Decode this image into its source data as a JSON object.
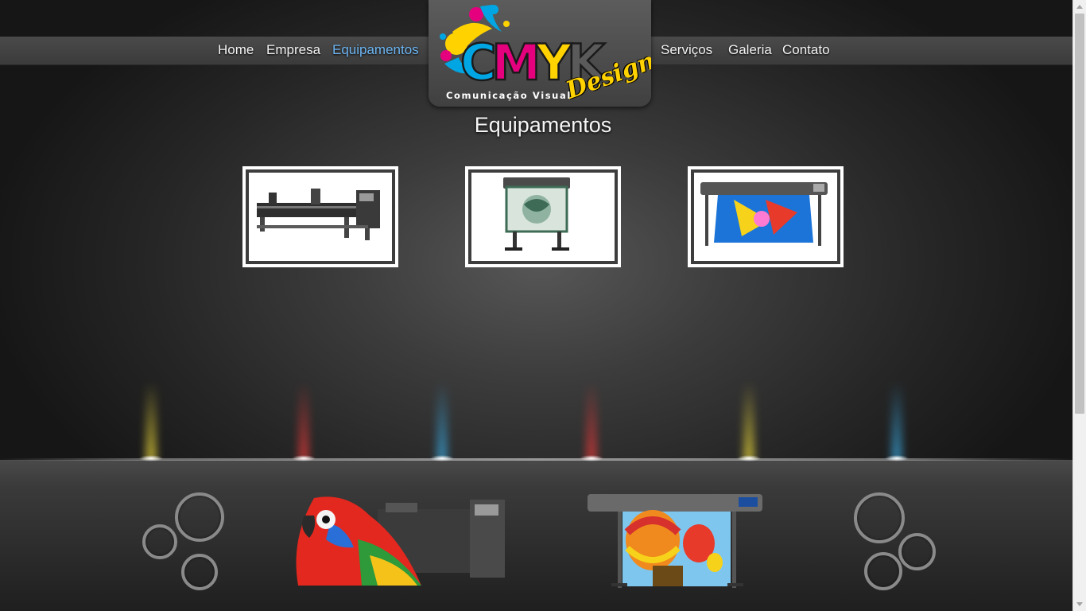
{
  "nav": {
    "items": [
      {
        "label": "Home",
        "active": false
      },
      {
        "label": "Empresa",
        "active": false
      },
      {
        "label": "Equipamentos",
        "active": true
      },
      {
        "label": "Serviços",
        "active": false
      },
      {
        "label": "Galeria",
        "active": false
      },
      {
        "label": "Contato",
        "active": false
      }
    ]
  },
  "logo": {
    "letters": "CMYK",
    "script": "Design",
    "tagline": "Comunicação Visual"
  },
  "page": {
    "title": "Equipamentos"
  },
  "equipment": [
    {
      "icon": "wide-format-printer-icon"
    },
    {
      "icon": "vinyl-cutter-plotter-icon"
    },
    {
      "icon": "print-and-cut-printer-icon"
    }
  ],
  "footer_banner": {
    "images": [
      "parrot-printer-image",
      "balloon-printer-image"
    ]
  },
  "colors": {
    "nav_active": "#6db6f3",
    "cyan": "#00a6e3",
    "magenta": "#e5007d",
    "yellow": "#ffd200"
  }
}
